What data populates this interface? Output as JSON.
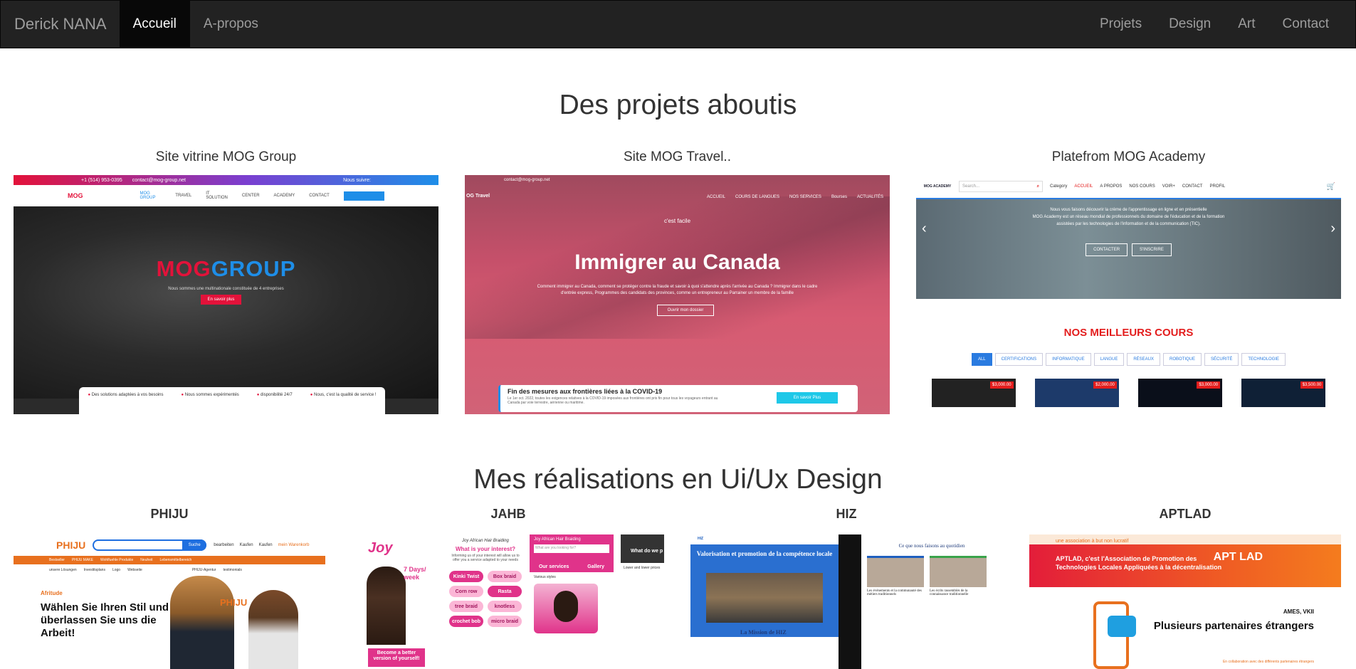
{
  "navbar": {
    "brand": "Derick NANA",
    "left_items": [
      "Accueil",
      "A-propos"
    ],
    "active_item": "Accueil",
    "right_items": [
      "Projets",
      "Design",
      "Art",
      "Contact"
    ]
  },
  "projects": {
    "title": "Des projets aboutis",
    "cards": [
      {
        "title": "Site vitrine MOG Group",
        "topbar_phone": "+1 (514) 953-0395",
        "topbar_email": "contact@mog-group.net",
        "topbar_follow": "Nous suivre:",
        "nav": [
          "MOG GROUP",
          "TRAVEL",
          "IT SOLUTION",
          "CENTER",
          "ACADEMY",
          "CONTACT"
        ],
        "hero_logo_red": "MOG",
        "hero_logo_blue": "GROUP",
        "hero_sub": "Nous sommes une multinationale constituée de 4 entreprises",
        "hero_button": "En savoir plus",
        "features": [
          "Des solutions adaptées à vos besoins",
          "Nous sommes expérimentés",
          "disponibilité 24/7",
          "Nous, c'est la qualité de service !"
        ]
      },
      {
        "title": "Site MOG Travel..",
        "topbar_email": "contact@mog-group.net",
        "brand": "OG Travel",
        "nav": [
          "ACCUEIL",
          "COURS DE LANGUES",
          "NOS SERVICES",
          "Bourses",
          "ACTUALITÉS"
        ],
        "hero_small": "c'est facile",
        "hero_title": "Immigrer au Canada",
        "hero_desc": "Comment immigrer au Canada, comment se protéger contre la fraude et savoir à quoi s'attendre après l'arrivée au Canada ? Immigrer dans le cadre d'entrée express, Programmes des candidats des provinces, comme un entrepreneur au Parrainer un membre de la famille",
        "hero_button": "Ouvrir mon dossier",
        "card_title": "Fin des mesures aux frontières liées à la COVID-19",
        "card_desc": "Le 1er oct. 2022, toutes les exigences relatives à la COVID-19 imposées aux frontières ont pris fin pour tous les voyageurs entrant au Canada par voie terrestre, aérienne ou maritime.",
        "card_button": "En savoir Plus"
      },
      {
        "title": "Platefrom MOG Academy",
        "logo_text": "MOG ACADEMY",
        "search_placeholder": "Search...",
        "nav": [
          "Category",
          "ACCUEIL",
          "A PROPOS",
          "NOS COURS",
          "VOIR+",
          "CONTACT",
          "PROFIL"
        ],
        "hero_line1": "Nous vous faisons découvrir la crème de l'apprentissage en ligne et en présentielle",
        "hero_line2": "MOG Academy est un réseau mondial de professionnels du domaine de l'éducation et de la formation assistées par les technologies de l'information et de la communication (TIC).",
        "hero_buttons": [
          "CONTACTER",
          "S'INSCRIRE"
        ],
        "courses_title": "NOS MEILLEURS COURS",
        "filters": [
          "ALL",
          "CERTIFICATIONS",
          "INFORMATIQUE",
          "LANGUE",
          "RÉSEAUX",
          "ROBOTIQUE",
          "SÉCURITÉ",
          "TECHNOLOGIE"
        ],
        "active_filter": "ALL",
        "prices": [
          "$3,000.00",
          "$2,000.00",
          "$3,000.00",
          "$3,500.00"
        ]
      }
    ]
  },
  "design": {
    "title": "Mes réalisations en Ui/Ux Design",
    "cards": [
      {
        "title": "PHIJU",
        "logo": "PHIJU",
        "search_button": "Suche",
        "icons": [
          "bearbeiten",
          "Kaufen",
          "Kaufen",
          "mein Warenkorb"
        ],
        "bar_items": [
          "Bestseller",
          "PHIJU MAKE",
          "Wohlfuehle Produkte",
          "Neuheit",
          "Lebensmittelbereich"
        ],
        "sub_items": [
          "unsere Lösungen",
          "Investitsplans",
          "Logo",
          "Webseite",
          "PHIJU-Agentur",
          "testimonials"
        ],
        "hero_small": "Afritude",
        "hero_tagline": "Wählen Sie Ihren Stil und überlassen Sie uns die Arbeit!"
      },
      {
        "title": "JAHB",
        "logo": "Joy",
        "days": "7 Days/ week",
        "cta": "Become a better version of yourself!",
        "col2_head": "Joy African Hair Braiding",
        "question": "What is your interest?",
        "question_sub": "Informing us of your interest will allow us to offer you a service adapted to your needs",
        "tags": [
          "Kinki Twist",
          "Box braid",
          "Corn row",
          "Rasta",
          "tree braid",
          "knotless",
          "crochet bob",
          "micro braid"
        ],
        "col3_head": "Joy African Hair Braiding",
        "col3_search": "What are you looking for?",
        "col3_tabs": [
          "Our services",
          "Gallery"
        ],
        "col3_label": "Various styles",
        "col4_head": "What do we p",
        "col4_label": "Lower and lower prices"
      },
      {
        "title": "HIZ",
        "banner_title": "Valorisation et promotion de la compétence locale",
        "mission": "La Mission de HIZ",
        "p2_title": "Ce que nous faisons au quotidien",
        "p2_caps": [
          "Les évènements et la communauté des métiers traditionnels",
          "Les écrits rassemblés de la connaissance traditionnelle"
        ]
      },
      {
        "title": "APTLAD",
        "top_text": "une association à but non lucratif",
        "banner_text": "APTLAD, c'est l'Association de Promotion des Technologies Locales Appliquées à la décentralisation",
        "logo": "APT LAD",
        "location": "AMES, VKII",
        "tagline": "Plusieurs partenaires étrangers",
        "footer": "En collaboration avec des différents partenaires étrangers"
      }
    ]
  },
  "colors": {
    "navbar_bg": "#222222",
    "navbar_active": "#080808",
    "mog_red": "#e3123a",
    "mog_blue": "#1e8ee8",
    "academy_red": "#e31d1d",
    "phiju_orange": "#e8701e",
    "jahb_pink": "#e0338a"
  }
}
